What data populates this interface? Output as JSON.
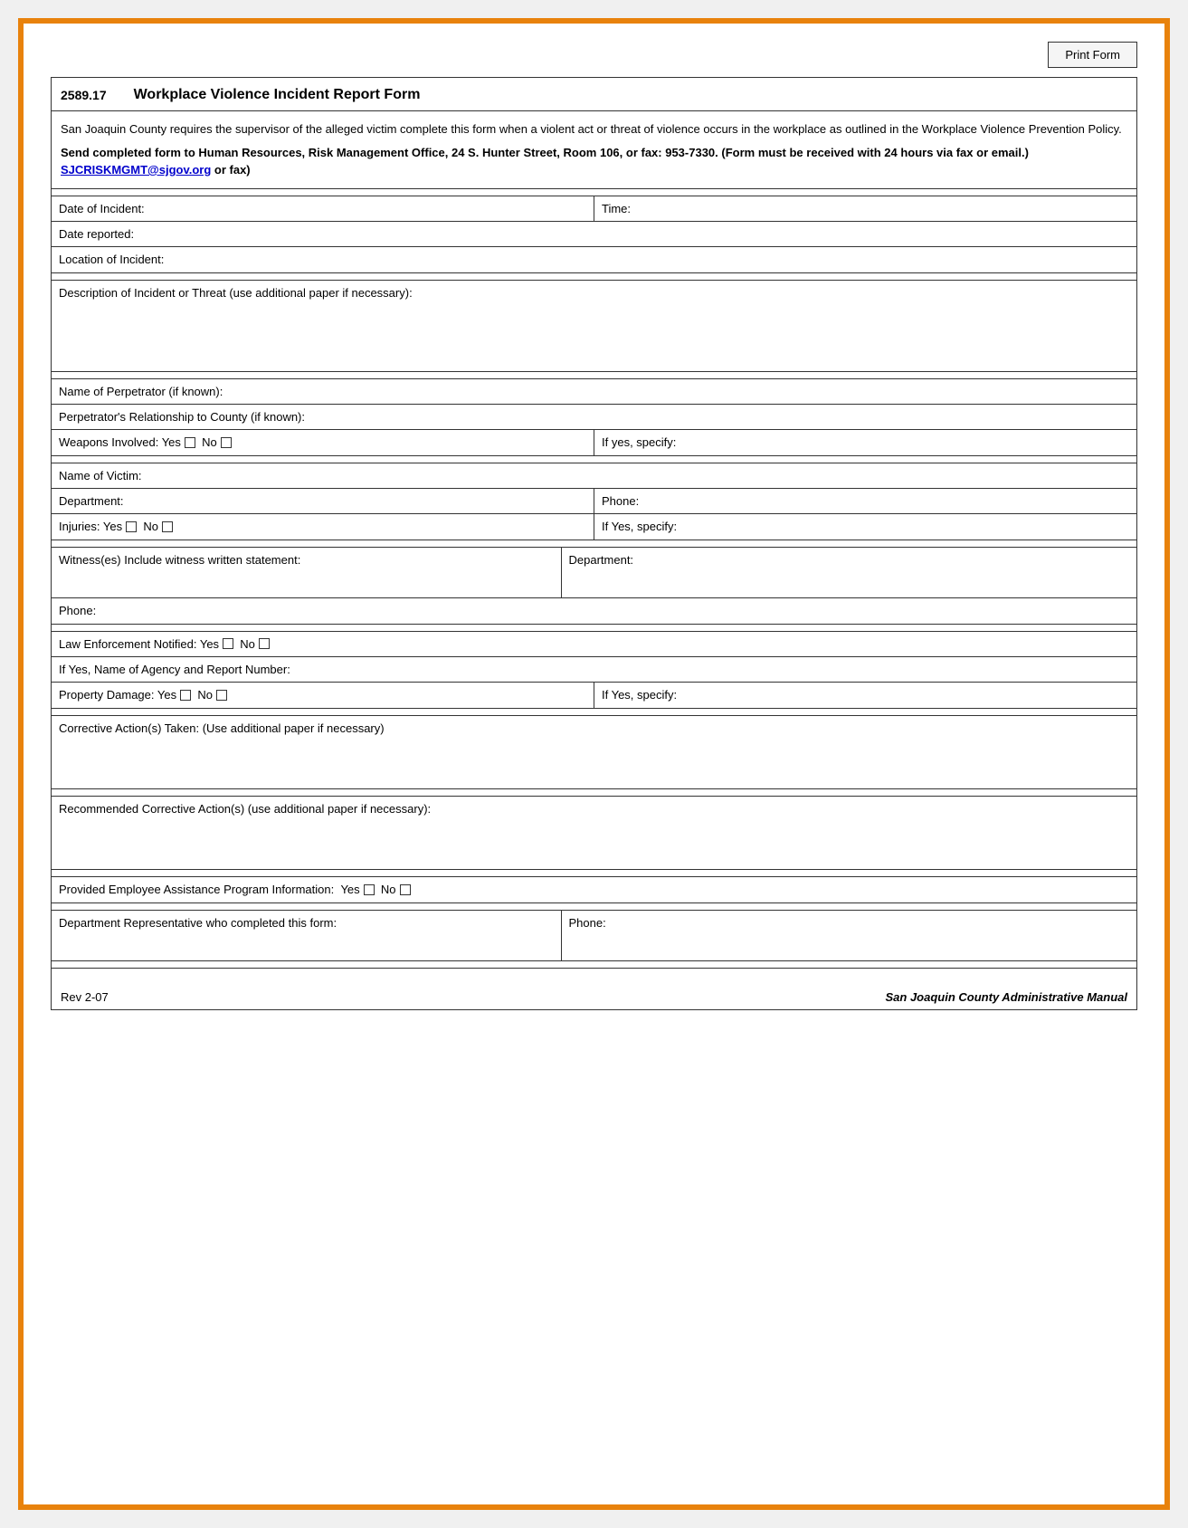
{
  "print_button": "Print Form",
  "form_number": "2589.17",
  "form_title": "Workplace Violence Incident Report Form",
  "intro_text1": "San Joaquin County requires the supervisor of the alleged victim complete this form when a violent act or threat of violence occurs in the workplace as outlined in the Workplace Violence Prevention Policy.",
  "intro_text2": "Send completed form to Human Resources, Risk Management Office, 24 S. Hunter Street, Room 106, or fax: 953-7330. (Form must be received with 24 hours via fax or email.)",
  "intro_email": "SJCRISKMGMT@sjgov.org",
  "intro_text3": " or fax)",
  "labels": {
    "date_of_incident": "Date of Incident:",
    "time": "Time:",
    "date_reported": "Date reported:",
    "location": "Location of Incident:",
    "description": "Description of Incident or Threat (use additional paper if necessary):",
    "perpetrator_name": "Name of Perpetrator (if known):",
    "perpetrator_relationship": "Perpetrator's Relationship to County (if known):",
    "weapons": "Weapons Involved: Yes",
    "weapons_no": "No",
    "weapons_specify": "If yes, specify:",
    "victim_name": "Name of Victim:",
    "department": "Department:",
    "phone": "Phone:",
    "injuries": "Injuries: Yes",
    "injuries_no": "No",
    "injuries_specify": "If Yes, specify:",
    "witness": "Witness(es) Include witness written statement:",
    "witness_dept": "Department:",
    "witness_phone": "Phone:",
    "law_enforcement": "Law Enforcement Notified: Yes",
    "law_enforcement_no": "No",
    "agency_report": "If Yes, Name of Agency and Report Number:",
    "property_damage": "Property Damage: Yes",
    "property_damage_no": "No",
    "property_specify": "If Yes, specify:",
    "corrective_action": "Corrective Action(s) Taken: (Use additional paper if necessary)",
    "recommended_corrective": "Recommended Corrective Action(s) (use additional paper if necessary):",
    "employee_assistance": "Provided Employee Assistance Program Information:",
    "employee_assistance_yes": "Yes",
    "employee_assistance_no": "No",
    "dept_rep": "Department Representative who completed this form:",
    "dept_rep_phone": "Phone:",
    "revision": "Rev 2-07",
    "manual": "San Joaquin County Administrative Manual"
  }
}
